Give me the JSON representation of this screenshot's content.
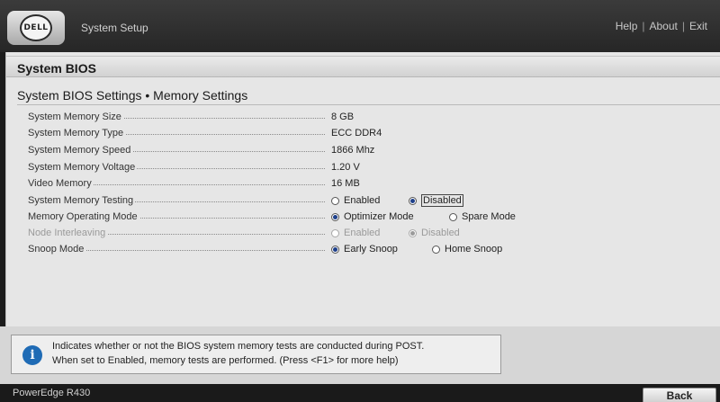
{
  "header": {
    "logo_text": "DELL",
    "app_title": "System Setup",
    "links": {
      "help": "Help",
      "about": "About",
      "exit": "Exit",
      "separator": "|"
    }
  },
  "page": {
    "section_title": "System BIOS",
    "subtitle": "System BIOS Settings • Memory Settings"
  },
  "settings": {
    "memory_size": {
      "label": "System Memory Size",
      "value": "8 GB"
    },
    "memory_type": {
      "label": "System Memory Type",
      "value": "ECC DDR4"
    },
    "memory_speed": {
      "label": "System Memory Speed",
      "value": "1866 Mhz"
    },
    "memory_voltage": {
      "label": "System Memory Voltage",
      "value": "1.20 V"
    },
    "video_memory": {
      "label": "Video Memory",
      "value": "16 MB"
    },
    "memory_testing": {
      "label": "System Memory Testing",
      "options": [
        "Enabled",
        "Disabled"
      ],
      "selected": "Disabled"
    },
    "operating_mode": {
      "label": "Memory Operating Mode",
      "options": [
        "Optimizer Mode",
        "Spare Mode"
      ],
      "selected": "Optimizer Mode"
    },
    "node_interleaving": {
      "label": "Node Interleaving",
      "options": [
        "Enabled",
        "Disabled"
      ],
      "selected": "Disabled",
      "state": "disabled"
    },
    "snoop_mode": {
      "label": "Snoop Mode",
      "options": [
        "Early Snoop",
        "Home Snoop"
      ],
      "selected": "Early Snoop"
    }
  },
  "help": {
    "icon": "info-icon",
    "line1": "Indicates whether or not the BIOS system memory tests are conducted during POST.",
    "line2": "When set to Enabled, memory tests are performed. (Press <F1> for more help)"
  },
  "footer": {
    "model": "PowerEdge R430",
    "back_label": "Back"
  },
  "colors": {
    "accent": "#1f6bb5",
    "radio_selected": "#1d3f8a",
    "panel_bg": "#e6e6e6",
    "topbar_bg": "#2f2f2f"
  }
}
